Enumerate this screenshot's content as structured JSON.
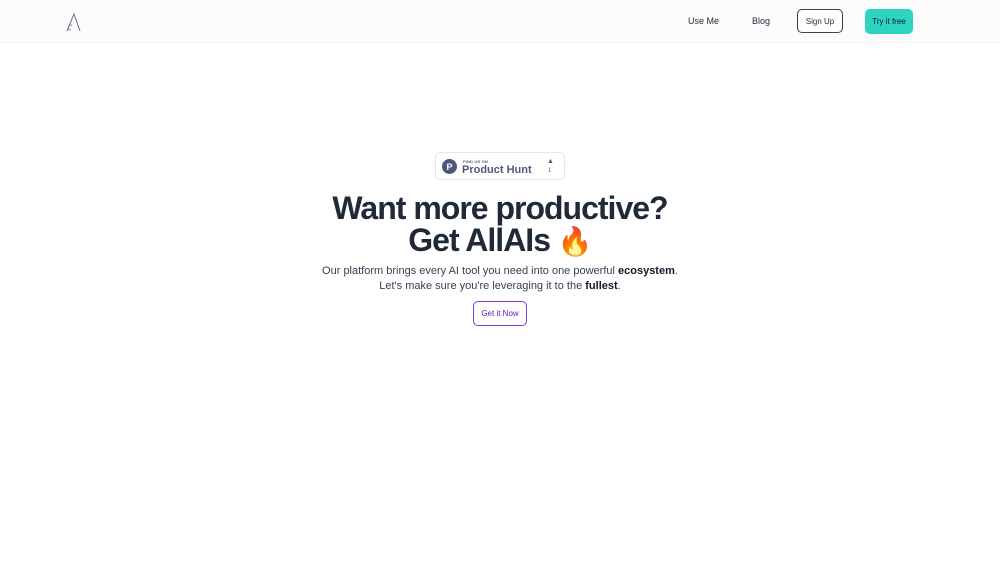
{
  "nav": {
    "links": [
      "Use Me",
      "Blog"
    ],
    "signup_label": "Sign Up",
    "try_label": "Try it free",
    "try_color": "#2dd4bf"
  },
  "badge": {
    "small": "FIND US ON",
    "big": "Product Hunt",
    "count": "1",
    "logo_letter": "P"
  },
  "hero": {
    "line1": "Want more productive?",
    "line2": "Get AllAIs",
    "emoji": "🔥",
    "sub1_prefix": "Our platform brings every AI tool you need into one powerful",
    "sub1_bold": "ecosystem",
    "sub2_prefix": "Let's make sure you're leveraging it to the",
    "sub2_bold": "fullest",
    "cta": "Get it Now",
    "cta_color": "#7c3aed"
  }
}
